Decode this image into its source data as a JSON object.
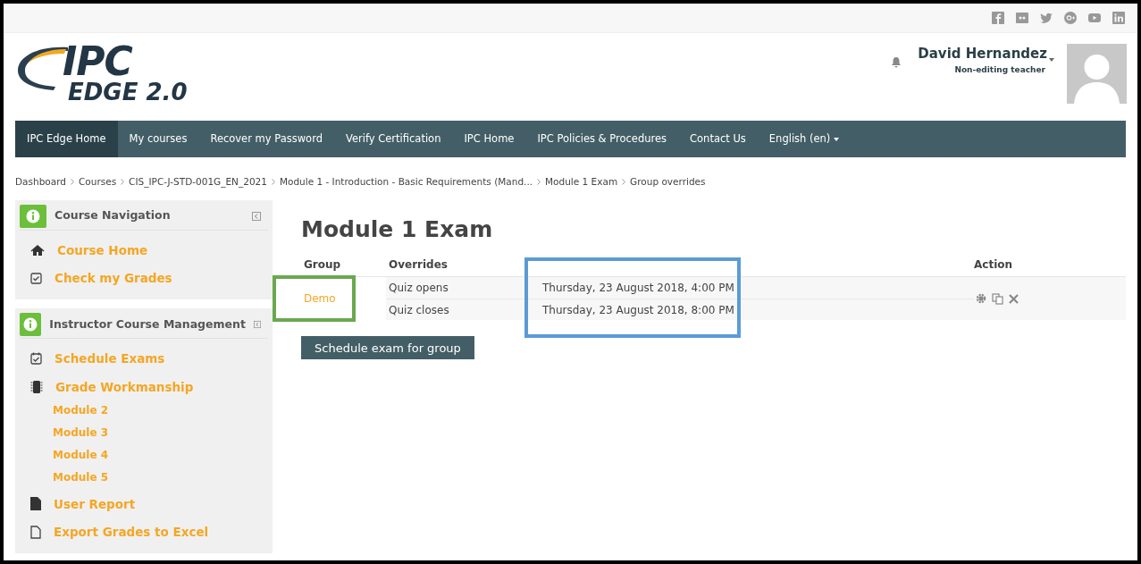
{
  "logo": {
    "line_1": "IPC",
    "line_2": "EDGE 2.0"
  },
  "user": {
    "name": "David Hernandez",
    "role": "Non-editing teacher"
  },
  "nav": [
    {
      "label": "IPC Edge Home",
      "selected": true
    },
    {
      "label": "My courses",
      "selected": false
    },
    {
      "label": "Recover my Password",
      "selected": false
    },
    {
      "label": "Verify Certification",
      "selected": false
    },
    {
      "label": "IPC Home",
      "selected": false
    },
    {
      "label": "IPC Policies & Procedures",
      "selected": false
    },
    {
      "label": "Contact Us",
      "selected": false
    },
    {
      "label": "English (en)",
      "selected": false,
      "dropdown": true
    }
  ],
  "breadcrumb": [
    "Dashboard",
    "Courses",
    "CIS_IPC-J-STD-001G_EN_2021",
    "Module 1 - Introduction - Basic Requirements (Mand...",
    "Module 1 Exam",
    "Group overrides"
  ],
  "sidebar": [
    {
      "title": "Course Navigation",
      "items": [
        {
          "label": "Course Home"
        },
        {
          "label": "Check my Grades"
        }
      ]
    },
    {
      "title": "Instructor Course Management",
      "items": [
        {
          "label": "Schedule Exams"
        },
        {
          "label": "Grade Workmanship",
          "children": [
            {
              "label": "Module 2"
            },
            {
              "label": "Module 3"
            },
            {
              "label": "Module 4"
            },
            {
              "label": "Module 5"
            }
          ]
        },
        {
          "label": "User Report"
        },
        {
          "label": "Export Grades to Excel"
        }
      ]
    }
  ],
  "page_title": "Module 1 Exam",
  "table": {
    "columns": [
      "Group",
      "Overrides",
      "Action"
    ],
    "rows": [
      {
        "group": "Demo",
        "overrides": [
          {
            "name": "Quiz opens",
            "value": "Thursday, 23 August 2018, 4:00 PM"
          },
          {
            "name": "Quiz closes",
            "value": "Thursday, 23 August 2018, 8:00 PM"
          }
        ]
      }
    ]
  },
  "highlights": [
    {
      "color": "#6aa84f"
    },
    {
      "color": "#5b9bd5"
    }
  ],
  "button": "Schedule exam for group"
}
